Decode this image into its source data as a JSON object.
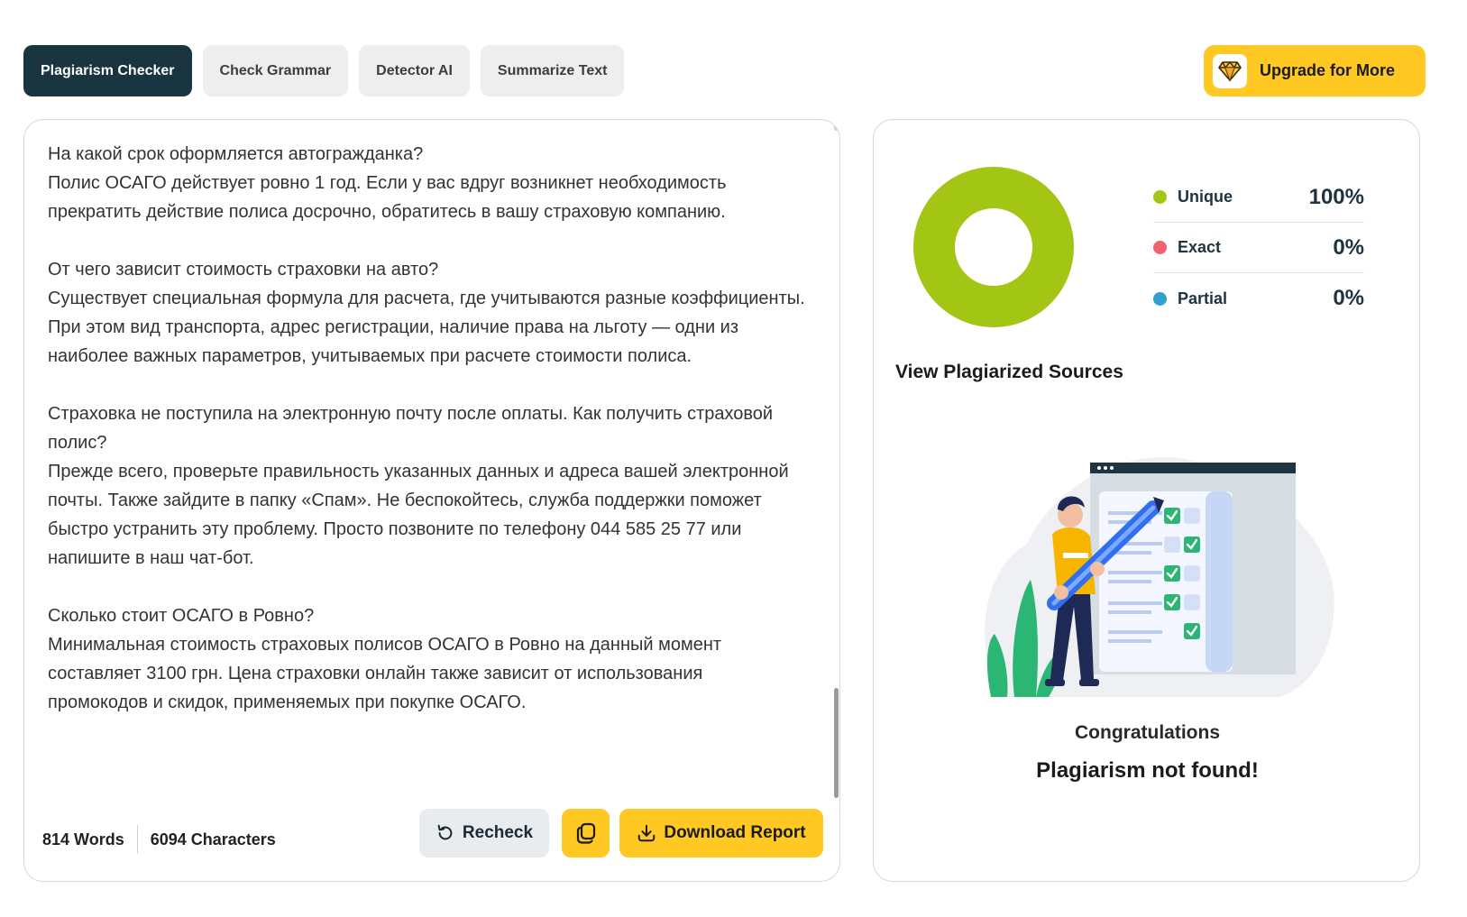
{
  "tabs": [
    {
      "label": "Plagiarism Checker",
      "active": true
    },
    {
      "label": "Check Grammar",
      "active": false
    },
    {
      "label": "Detector AI",
      "active": false
    },
    {
      "label": "Summarize Text",
      "active": false
    }
  ],
  "upgrade": {
    "label": "Upgrade for More",
    "icon": "diamond-icon"
  },
  "editor": {
    "text": "На какой срок оформляется автогражданка?\nПолис ОСАГО действует ровно 1 год. Если у вас вдруг возникнет необходимость прекратить действие полиса досрочно, обратитесь в вашу страховую компанию.\n\nОт чего зависит стоимость страховки на авто?\nСуществует специальная формула для расчета, где учитываются разные коэффициенты. При этом вид транспорта, адрес регистрации, наличие права на льготу — одни из наиболее важных параметров, учитываемых при расчете стоимости полиса.\n\nСтраховка не поступила на электронную почту после оплаты. Как получить страховой полис?\nПрежде всего, проверьте правильность указанных данных и адреса вашей электронной почты. Также зайдите в папку «Спам». Не беспокойтесь, служба поддержки поможет быстро устранить эту проблему. Просто позвоните по телефону 044 585 25 77 или напишите в наш чат-бот.\n\nСколько стоит ОСАГО в Ровно?\nМинимальная стоимость страховых полисов ОСАГО в Ровно на данный момент составляет 3100 грн. Цена страховки онлайн также зависит от использования промокодов и скидок, применяемых при покупке ОСАГО.",
    "words": "814 Words",
    "characters": "6094 Characters",
    "recheck_label": "Recheck",
    "download_label": "Download Report"
  },
  "results": {
    "legend": [
      {
        "name": "Unique",
        "value": "100%",
        "color": "#a3c614"
      },
      {
        "name": "Exact",
        "value": "0%",
        "color": "#f26170"
      },
      {
        "name": "Partial",
        "value": "0%",
        "color": "#2fa0cf"
      }
    ],
    "unique_fraction": 1.0,
    "donut_color": "#a3c614",
    "view_sources_label": "View Plagiarized Sources",
    "congrats": "Congratulations",
    "message": "Plagiarism not found!"
  },
  "colors": {
    "primary_dark": "#183540",
    "accent_yellow": "#ffc823"
  }
}
